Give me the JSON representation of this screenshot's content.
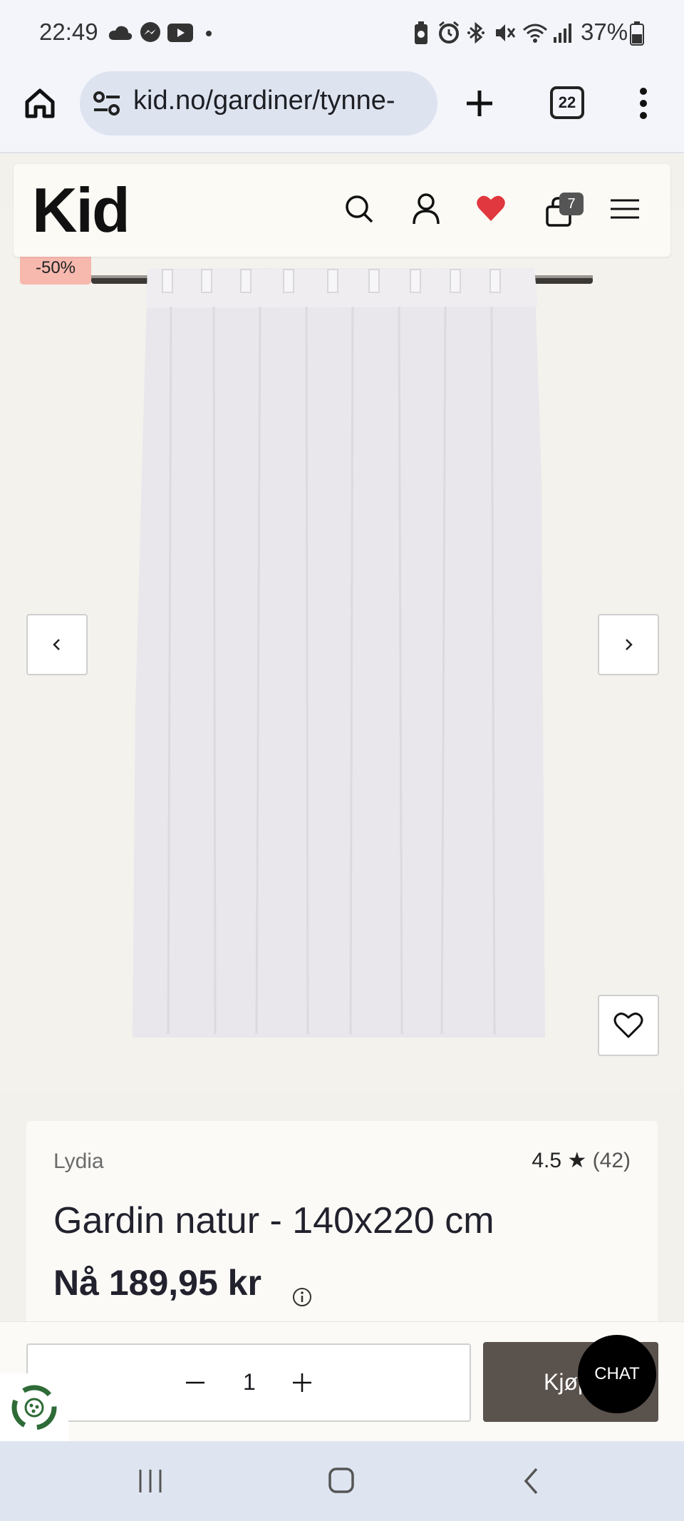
{
  "status_bar": {
    "time": "22:49",
    "battery_percent": "37%",
    "left_icons": [
      "cloud-icon",
      "messenger-icon",
      "youtube-icon",
      "dot-icon"
    ],
    "right_icons": [
      "battery-saver-icon",
      "alarm-icon",
      "bluetooth-icon",
      "mute-icon",
      "wifi-icon",
      "signal-icon",
      "battery-icon"
    ]
  },
  "browser": {
    "url": "kid.no/gardiner/tynne-",
    "tab_count": "22"
  },
  "site": {
    "logo": "Kid",
    "cart_count": "7",
    "colors": {
      "heart": "#e0383e",
      "badge": "#f7b8ae",
      "buy_button": "#5a524d"
    }
  },
  "product": {
    "discount": "-50%",
    "brand": "Lydia",
    "rating": "4.5",
    "rating_count": "(42)",
    "title": "Gardin natur - 140x220 cm",
    "price_prefix": "Nå",
    "price": "189,95 kr"
  },
  "purchase": {
    "quantity": "1",
    "buy_label": "Kjøp",
    "chat_label": "CHAT"
  }
}
